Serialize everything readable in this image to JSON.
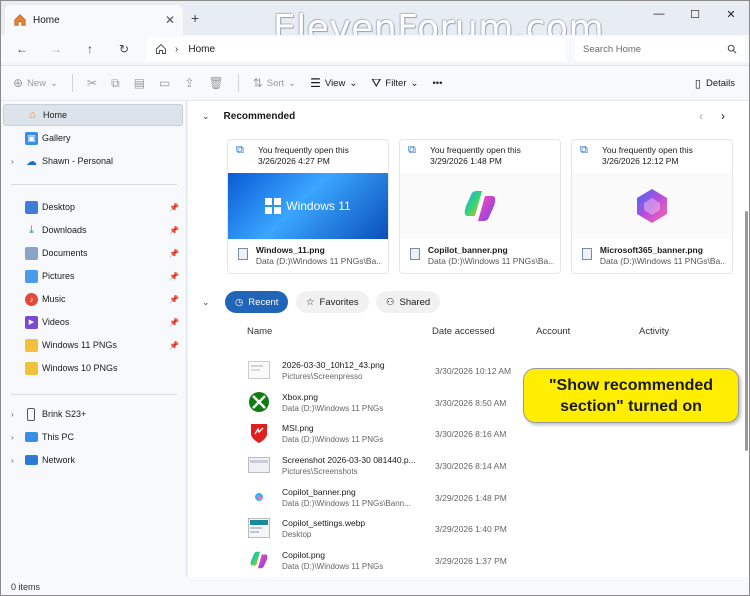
{
  "watermark": "ElevenForum.com",
  "tab": {
    "label": "Home",
    "close": "✕",
    "new_tab": "+"
  },
  "window_controls": {
    "minimize": "—",
    "maximize": "☐",
    "close": "✕"
  },
  "address": {
    "crumb": "Home",
    "separator": "›"
  },
  "search": {
    "placeholder": "Search Home"
  },
  "commands": {
    "new": "New",
    "sort": "Sort",
    "view": "View",
    "filter": "Filter",
    "more": "•••",
    "details": "Details"
  },
  "sidebar": {
    "items": [
      {
        "label": "Home"
      },
      {
        "label": "Gallery"
      },
      {
        "label": "Shawn - Personal"
      },
      {
        "label": "Desktop"
      },
      {
        "label": "Downloads"
      },
      {
        "label": "Documents"
      },
      {
        "label": "Pictures"
      },
      {
        "label": "Music"
      },
      {
        "label": "Videos"
      },
      {
        "label": "Windows 11 PNGs"
      },
      {
        "label": "Windows 10 PNGs"
      },
      {
        "label": "Brink S23+"
      },
      {
        "label": "This PC"
      },
      {
        "label": "Network"
      }
    ]
  },
  "recommended": {
    "title": "Recommended",
    "cards": [
      {
        "reason": "You frequently open this",
        "date": "3/26/2026 4:27 PM",
        "name": "Windows_11.png",
        "location": "Data (D:)\\Windows 11 PNGs\\Ba...",
        "thumb_text": "Windows 11"
      },
      {
        "reason": "You frequently open this",
        "date": "3/29/2026 1:48 PM",
        "name": "Copilot_banner.png",
        "location": "Data (D:)\\Windows 11 PNGs\\Ba..."
      },
      {
        "reason": "You frequently open this",
        "date": "3/26/2026 12:12 PM",
        "name": "Microsoft365_banner.png",
        "location": "Data (D:)\\Windows 11 PNGs\\Ba..."
      }
    ]
  },
  "filters": {
    "recent": "Recent",
    "favorites": "Favorites",
    "shared": "Shared"
  },
  "columns": {
    "name": "Name",
    "date": "Date accessed",
    "account": "Account",
    "activity": "Activity"
  },
  "files": [
    {
      "name": "2026-03-30_10h12_43.png",
      "location": "Pictures\\Screenpresso",
      "date": "3/30/2026 10:12 AM"
    },
    {
      "name": "Xbox.png",
      "location": "Data (D:)\\Windows 11 PNGs",
      "date": "3/30/2026 8:50 AM"
    },
    {
      "name": "MSI.png",
      "location": "Data (D:)\\Windows 11 PNGs",
      "date": "3/30/2026 8:16 AM"
    },
    {
      "name": "Screenshot 2026-03-30 081440.p...",
      "location": "Pictures\\Screenshots",
      "date": "3/30/2026 8:14 AM"
    },
    {
      "name": "Copilot_banner.png",
      "location": "Data (D:)\\Windows 11 PNGs\\Bann...",
      "date": "3/29/2026 1:48 PM"
    },
    {
      "name": "Copilot_settings.webp",
      "location": "Desktop",
      "date": "3/29/2026 1:40 PM"
    },
    {
      "name": "Copilot.png",
      "location": "Data (D:)\\Windows 11 PNGs",
      "date": "3/29/2026 1:37 PM"
    }
  ],
  "callout": "\"Show recommended section\" turned on",
  "status": "0 items",
  "colors": {
    "accent": "#2164b8",
    "callout_bg": "#ffee00"
  }
}
